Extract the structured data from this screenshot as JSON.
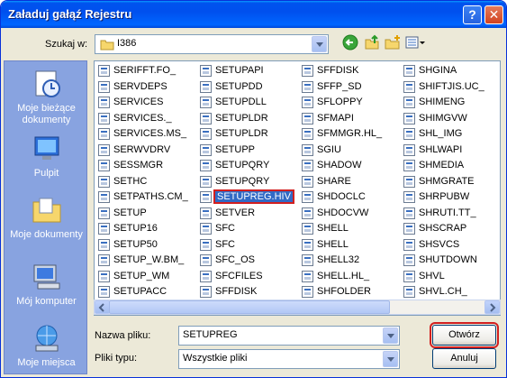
{
  "window": {
    "title": "Załaduj gałąź Rejestru",
    "help_icon": "?",
    "close_icon": "✕"
  },
  "look_in": {
    "label": "Szukaj w:",
    "value": "I386"
  },
  "toolbar": {
    "back": "back-icon",
    "up": "up-folder-icon",
    "new_folder": "new-folder-icon",
    "views": "views-menu-icon"
  },
  "places": [
    {
      "label": "Moje bieżące dokumenty",
      "icon": "recent-documents-icon"
    },
    {
      "label": "Pulpit",
      "icon": "desktop-icon"
    },
    {
      "label": "Moje dokumenty",
      "icon": "my-documents-icon"
    },
    {
      "label": "Mój komputer",
      "icon": "my-computer-icon"
    },
    {
      "label": "Moje miejsca",
      "icon": "network-places-icon"
    }
  ],
  "files": {
    "col1": [
      "SERIFFT.FO_",
      "SERVDEPS",
      "SERVICES",
      "SERVICES._",
      "SERVICES.MS_",
      "SERWVDRV",
      "SESSMGR",
      "SETHC",
      "SETPATHS.CM_",
      "SETUP",
      "SETUP16",
      "SETUP50",
      "SETUP_W.BM_",
      "SETUP_WM",
      "SETUPACC"
    ],
    "col2": [
      "SETUPAPI",
      "SETUPDD",
      "SETUPDLL",
      "SETUPLDR",
      "SETUPLDR",
      "SETUPP",
      "SETUPQRY",
      "SETUPQRY",
      "SETUPREG.HIV",
      "SETVER",
      "SFC",
      "SFC",
      "SFC_OS",
      "SFCFILES",
      "SFFDISK"
    ],
    "col3": [
      "SFFDISK",
      "SFFP_SD",
      "SFLOPPY",
      "SFMAPI",
      "SFMMGR.HL_",
      "SGIU",
      "SHADOW",
      "SHARE",
      "SHDOCLC",
      "SHDOCVW",
      "SHELL",
      "SHELL",
      "SHELL32",
      "SHELL.HL_",
      "SHFOLDER"
    ],
    "col4": [
      "SHGINA",
      "SHIFTJIS.UC_",
      "SHIMENG",
      "SHIMGVW",
      "SHL_IMG",
      "SHLWAPI",
      "SHMEDIA",
      "SHMGRATE",
      "SHRPUBW",
      "SHRUTI.TT_",
      "SHSCRAP",
      "SHSVCS",
      "SHUTDOWN",
      "SHVL",
      "SHVL.CH_"
    ]
  },
  "selected_file": "SETUPREG.HIV",
  "filename": {
    "label": "Nazwa pliku:",
    "value": "SETUPREG"
  },
  "filetype": {
    "label": "Pliki typu:",
    "value": "Wszystkie pliki"
  },
  "buttons": {
    "open": "Otwórz",
    "cancel": "Anuluj"
  }
}
